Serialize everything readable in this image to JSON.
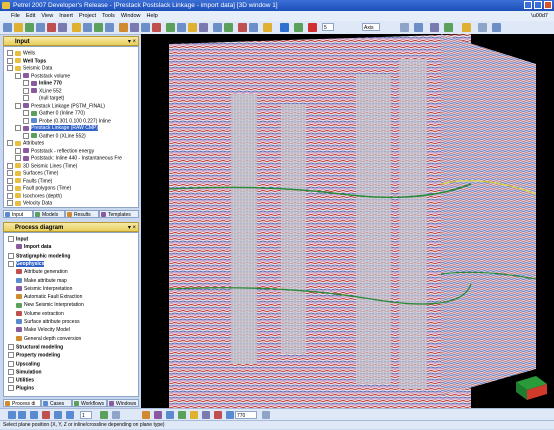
{
  "window": {
    "title": "Petrel 2007 Developer's Release - [Prestack Postslack Linkage - import data] [3D window 1]"
  },
  "menu": [
    "File",
    "Edit",
    "View",
    "Insert",
    "Project",
    "Tools",
    "Window",
    "Help"
  ],
  "toolbar": {
    "num_field": "5",
    "combo_field": "Axis"
  },
  "input_panel": {
    "title": "Input",
    "controls": "▾ ×",
    "tree": [
      {
        "label": "Wells",
        "indent": 0,
        "icon": "folder",
        "bold": false
      },
      {
        "label": "Well Tops",
        "indent": 0,
        "icon": "folder",
        "bold": true
      },
      {
        "label": "Seismic Data",
        "indent": 0,
        "icon": "folder",
        "bold": false
      },
      {
        "label": "Poststack volume",
        "indent": 1,
        "icon": "seismic",
        "bold": false
      },
      {
        "label": "Inline 770",
        "indent": 2,
        "icon": "seismic",
        "bold": true
      },
      {
        "label": "XLine 552",
        "indent": 2,
        "icon": "seismic",
        "bold": false
      },
      {
        "label": "(null target)",
        "indent": 2,
        "icon": "none",
        "bold": false
      },
      {
        "label": "Prestack Linkage (PSTM_FINAL)",
        "indent": 1,
        "icon": "seismic",
        "bold": false
      },
      {
        "label": "Gather 0 (Inline 770)",
        "indent": 2,
        "icon": "gather",
        "bold": false
      },
      {
        "label": "Probe (0.301 0.100 0.227) Inline",
        "indent": 2,
        "icon": "probe",
        "bold": false
      },
      {
        "label": "Prestack Linkage (RAW CMP)",
        "indent": 1,
        "icon": "seismic",
        "bold": false,
        "selected": true
      },
      {
        "label": "Gather 0 (XLine 552)",
        "indent": 2,
        "icon": "gather",
        "bold": false
      },
      {
        "label": "Attributes",
        "indent": 0,
        "icon": "folder",
        "bold": false
      },
      {
        "label": "Poststack - reflection energy",
        "indent": 1,
        "icon": "seismic",
        "bold": false
      },
      {
        "label": "Poststack: Inline 440 - Instantaneous Fre",
        "indent": 1,
        "icon": "seismic",
        "bold": false
      },
      {
        "label": "3D Seismic Lines (Time)",
        "indent": 0,
        "icon": "folder",
        "bold": false
      },
      {
        "label": "Surfaces (Time)",
        "indent": 0,
        "icon": "folder",
        "bold": false
      },
      {
        "label": "Faults (Time)",
        "indent": 0,
        "icon": "folder",
        "bold": false
      },
      {
        "label": "Fault polygons (Time)",
        "indent": 0,
        "icon": "folder",
        "bold": false
      },
      {
        "label": "Isochores (depth)",
        "indent": 0,
        "icon": "folder",
        "bold": false
      },
      {
        "label": "Velocity Data",
        "indent": 0,
        "icon": "folder",
        "bold": false
      }
    ],
    "tabs": [
      "Input",
      "Models",
      "Results",
      "Templates"
    ]
  },
  "process_panel": {
    "title": "Process diagram",
    "controls": "▾ ×",
    "items": [
      {
        "label": "Input",
        "cat": true
      },
      {
        "label": "Import data",
        "cat": false,
        "bold": true
      },
      {
        "label": "Stratigraphic modeling",
        "cat": true
      },
      {
        "label": "Geophysics",
        "cat": true,
        "selected": true
      },
      {
        "label": "Attribute generation",
        "cat": false
      },
      {
        "label": "Make attribute map",
        "cat": false
      },
      {
        "label": "Seismic Interpretation",
        "cat": false
      },
      {
        "label": "Automatic Fault Extraction",
        "cat": false
      },
      {
        "label": "New Seismic Interpretation",
        "cat": false
      },
      {
        "label": "Volume extraction",
        "cat": false
      },
      {
        "label": "Surface attribute process",
        "cat": false
      },
      {
        "label": "Make Velocity Model",
        "cat": false
      },
      {
        "label": "General depth conversion",
        "cat": false
      },
      {
        "label": "Structural modeling",
        "cat": true
      },
      {
        "label": "Property modeling",
        "cat": true
      },
      {
        "label": "Upscaling",
        "cat": true
      },
      {
        "label": "Simulation",
        "cat": true
      },
      {
        "label": "Utilities",
        "cat": true
      },
      {
        "label": "Plugins",
        "cat": true
      }
    ],
    "tabs": [
      "Process di",
      "Cases",
      "Workflows",
      "Windows"
    ]
  },
  "bottom_toolbar": {
    "page_field": "1",
    "value_field": "770"
  },
  "status": "Select plane position (X, Y, Z or inline/crossline depending on plane type)",
  "colors": {
    "title_blue": "#1c4fb8",
    "panel_head_gold": "#e8cf5c",
    "selection_blue": "#3264c8",
    "seismic_red": "#c0392b",
    "seismic_blue": "#2f4fa8"
  }
}
